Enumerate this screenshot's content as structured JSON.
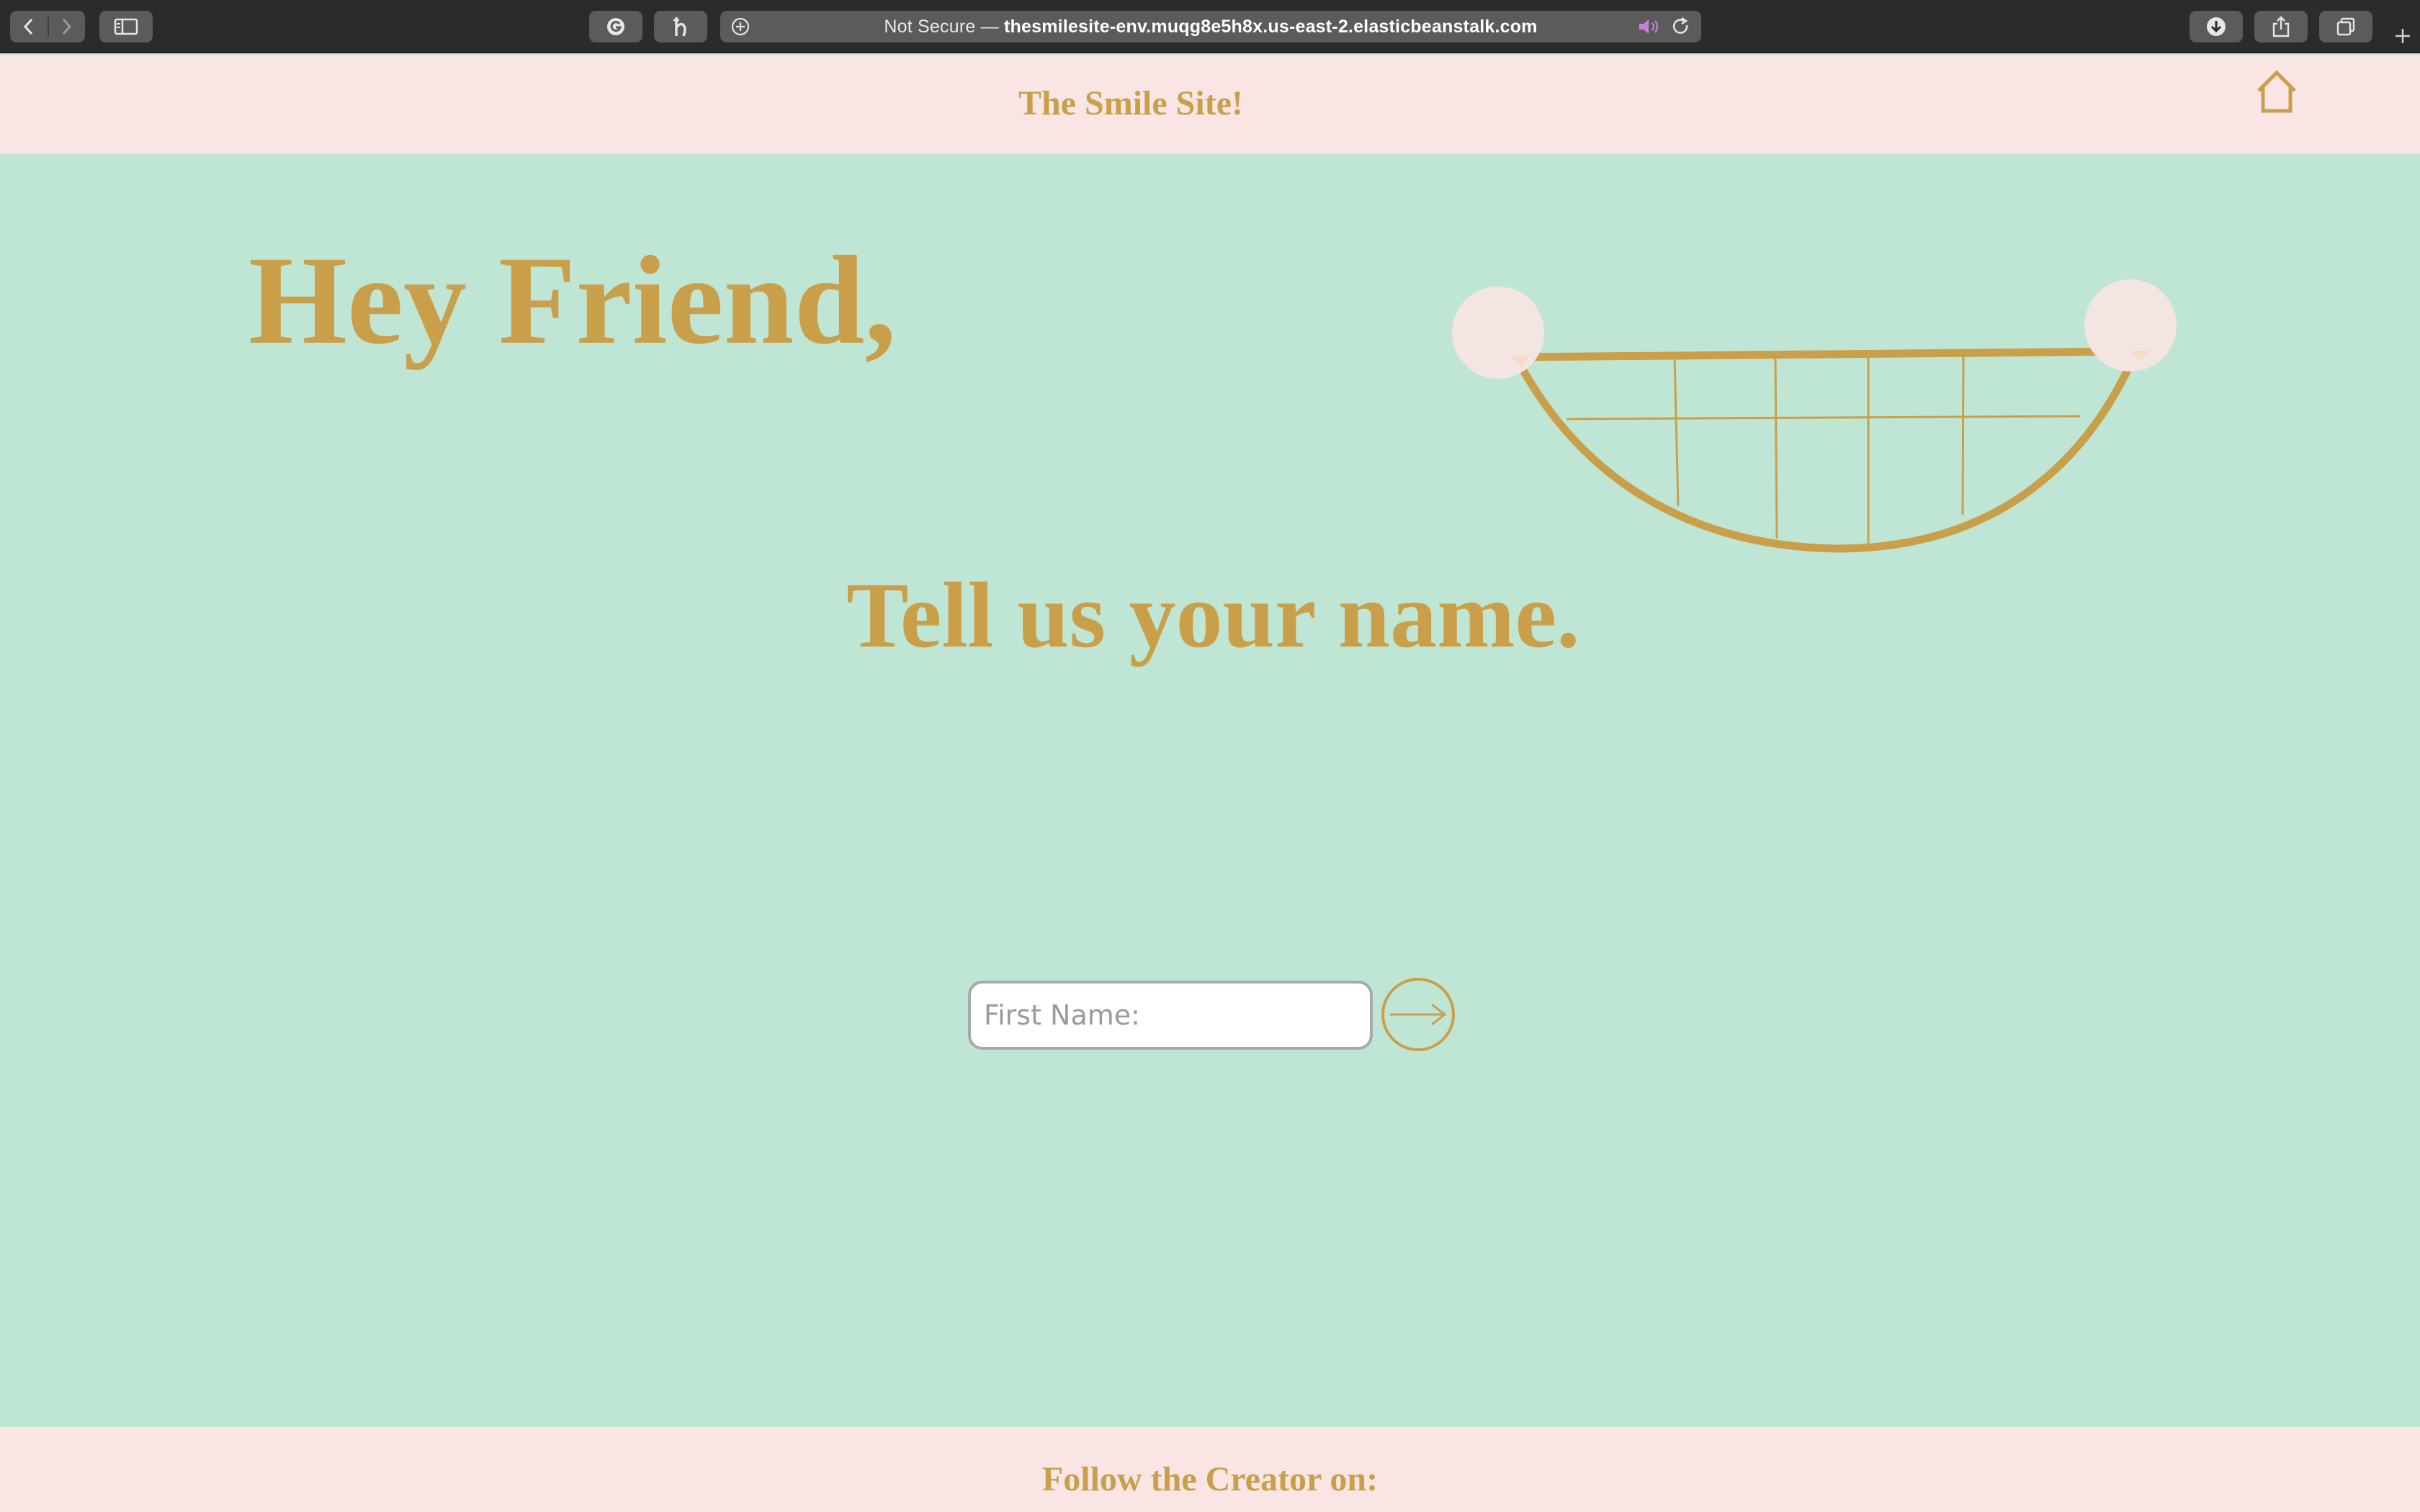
{
  "browser": {
    "address_prefix": "Not Secure —",
    "address_host": "thesmilesite-env.muqg8e5h8x.us-east-2.elasticbeanstalk.com",
    "icons": [
      "back-icon",
      "forward-icon",
      "sidebar-icon",
      "grammarly-icon",
      "honey-icon",
      "add-tab-icon",
      "speaker-icon",
      "reload-icon",
      "download-icon",
      "share-icon",
      "tabs-overview-icon",
      "new-tab-icon"
    ]
  },
  "header": {
    "title": "The Smile Site!",
    "home_icon": "home-icon"
  },
  "main": {
    "greeting": "Hey Friend,",
    "prompt": "Tell us your name.",
    "name_input": {
      "placeholder": "First Name:",
      "value": ""
    },
    "submit_icon": "arrow-right-icon"
  },
  "footer": {
    "text": "Follow the Creator on:"
  },
  "colors": {
    "accent": "#c99f4a",
    "background": "#bfe6d5",
    "header_footer": "#f9e5e4",
    "smile_dots": "#f4e4e2"
  }
}
